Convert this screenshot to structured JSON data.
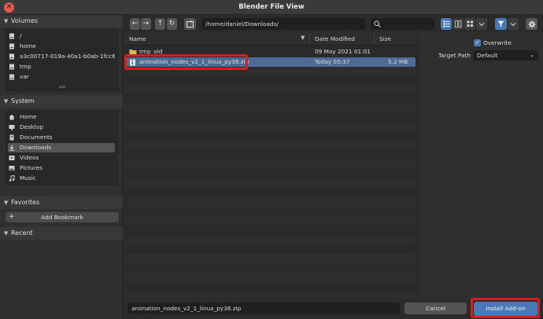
{
  "window": {
    "title": "Blender File View",
    "close_glyph": "✕"
  },
  "sidebar": {
    "volumes": {
      "label": "Volumes",
      "items": [
        "/",
        "home",
        "a3c00717-019a-40a1-b0ab-1fcc6a...",
        "tmp",
        "var"
      ]
    },
    "system": {
      "label": "System",
      "items": [
        "Home",
        "Desktop",
        "Documents",
        "Downloads",
        "Videos",
        "Pictures",
        "Music"
      ],
      "active": "Downloads"
    },
    "favorites": {
      "label": "Favorites",
      "add_bookmark_label": "Add Bookmark",
      "plus_glyph": "+"
    },
    "recent": {
      "label": "Recent"
    }
  },
  "toolbar": {
    "back_glyph": "←",
    "forward_glyph": "→",
    "parent_glyph": "↑",
    "refresh_glyph": "↻",
    "path": "/home/daniel/Downloads/",
    "search_placeholder": ""
  },
  "filelist": {
    "columns": {
      "name": "Name",
      "date": "Date Modified",
      "size": "Size"
    },
    "rows": [
      {
        "name": "tmp_old",
        "date": "09 May 2021 01:01",
        "size": "",
        "icon": "folder-icon"
      },
      {
        "name": "animation_nodes_v2_1_linux_py38.zip",
        "date": "Today 05:37",
        "size": "5.2 MB",
        "icon": "zip-file-icon",
        "selected": true
      }
    ]
  },
  "options": {
    "overwrite_label": "Overwrite",
    "overwrite_checked": true,
    "check_glyph": "✓",
    "target_path_label": "Target Path",
    "target_path_value": "Default"
  },
  "bottom": {
    "filename": "animation_nodes_v2_1_linux_py38.zip",
    "cancel_label": "Cancel",
    "install_label": "Install Add-on"
  },
  "colors": {
    "accent": "#4a7ab5",
    "selection": "#4f6a94",
    "highlight": "#d91c1c"
  }
}
